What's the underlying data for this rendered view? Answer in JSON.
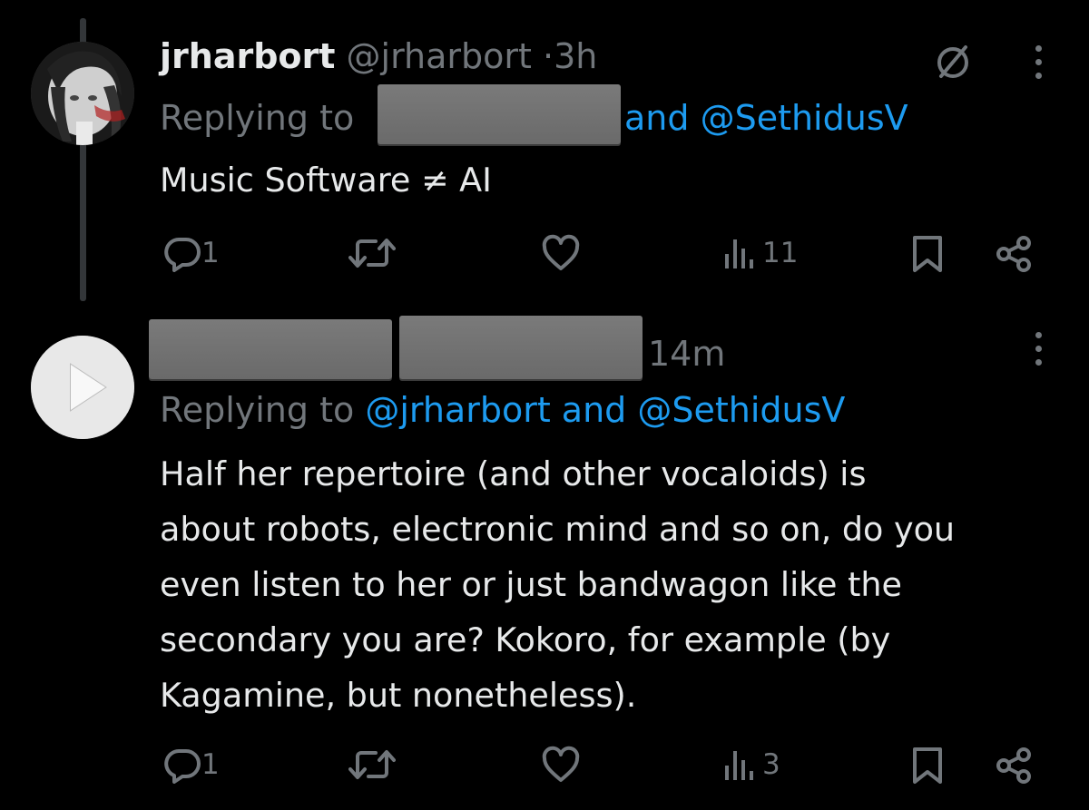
{
  "tweets": [
    {
      "display_name": "jrharbort",
      "handle": "@jrharbort",
      "separator": "·",
      "time": "3h",
      "replying_prefix": "Replying to",
      "replying_visible_suffix": "and @SethidusV",
      "body": "Music Software ≠ AI",
      "actions": {
        "replies": "1",
        "views": "11"
      },
      "icons": [
        "grok-icon",
        "more-icon",
        "reply-icon",
        "retweet-icon",
        "like-icon",
        "views-icon",
        "bookmark-icon",
        "share-icon"
      ]
    },
    {
      "display_name": "",
      "handle": "",
      "time": "14m",
      "replying_prefix": "Replying to",
      "replying_users": "@jrharbort and @SethidusV",
      "body_lines": [
        "Half her repertoire (and other vocaloids) is",
        "about robots, electronic mind and so on, do you",
        "even listen to her or just bandwagon like the",
        "secondary you are? Kokoro, for example (by",
        "Kagamine, but nonetheless)."
      ],
      "actions": {
        "replies": "1",
        "views": "3"
      },
      "icons": [
        "play-icon",
        "more-icon",
        "reply-icon",
        "retweet-icon",
        "like-icon",
        "views-icon",
        "bookmark-icon",
        "share-icon"
      ]
    }
  ],
  "colors": {
    "background": "#000000",
    "text": "#e7e9ea",
    "muted": "#71767b",
    "link": "#1d9bf0",
    "redaction": "#707070"
  }
}
